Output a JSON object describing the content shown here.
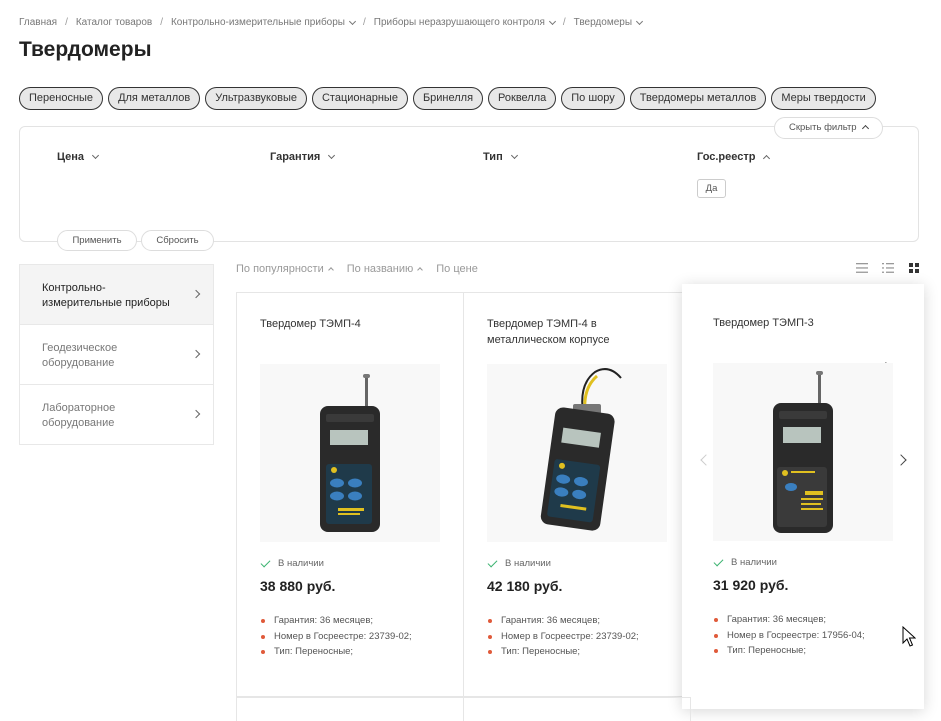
{
  "breadcrumb": [
    {
      "label": "Главная",
      "dropdown": false
    },
    {
      "label": "Каталог товаров",
      "dropdown": false
    },
    {
      "label": "Контрольно-измерительные приборы",
      "dropdown": true
    },
    {
      "label": "Приборы неразрушающего контроля",
      "dropdown": true
    },
    {
      "label": "Твердомеры",
      "dropdown": true
    }
  ],
  "page_title": "Твердомеры",
  "tags": [
    "Переносные",
    "Для металлов",
    "Ультразвуковые",
    "Стационарные",
    "Бринелля",
    "Роквелла",
    "По шору",
    "Твердомеры металлов",
    "Меры твердости"
  ],
  "filter": {
    "hide_label": "Скрыть фильтр",
    "columns": [
      "Цена",
      "Гарантия",
      "Тип",
      "Гос.реестр"
    ],
    "registry_option": "Да",
    "apply_label": "Применить",
    "reset_label": "Сбросить"
  },
  "side_menu": [
    {
      "label": "Контрольно-измерительные приборы",
      "active": true
    },
    {
      "label": "Геодезическое оборудование",
      "active": false
    },
    {
      "label": "Лабораторное оборудование",
      "active": false
    }
  ],
  "sort": {
    "popularity": "По популярности",
    "name": "По названию",
    "price": "По цене"
  },
  "view_icons": [
    "list-view-icon",
    "compact-list-view-icon",
    "grid-view-icon"
  ],
  "products": [
    {
      "name": "Твердомер ТЭМП-4",
      "stock": "В наличии",
      "price": "38 880 руб.",
      "specs": [
        "Гарантия: 36 месяцев;",
        "Номер в Госреестре: 23739-02;",
        "Тип: Переносные;"
      ]
    },
    {
      "name": "Твердомер ТЭМП-4 в металлическом корпусе",
      "stock": "В наличии",
      "price": "42 180 руб.",
      "specs": [
        "Гарантия: 36 месяцев;",
        "Номер в Госреестре: 23739-02;",
        "Тип: Переносные;"
      ]
    },
    {
      "name": "Твердомер ТЭМП-3",
      "stock": "В наличии",
      "price": "31 920 руб.",
      "specs": [
        "Гарантия: 36 месяцев;",
        "Номер в Госреестре: 17956-04;",
        "Тип: Переносные;"
      ]
    }
  ],
  "colors": {
    "accent_dot": "#e05a3a",
    "in_stock_check": "#3cb371",
    "device_body": "#2a2a2a",
    "device_panel": "#1f3a4a",
    "device_panel_tmp3": "#3a3a3a"
  }
}
